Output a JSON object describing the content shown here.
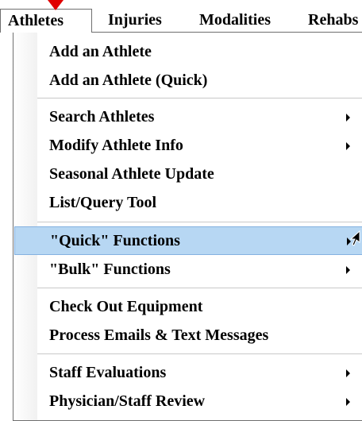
{
  "menubar": {
    "items": [
      {
        "label": "Athletes"
      },
      {
        "label": "Injuries"
      },
      {
        "label": "Modalities"
      },
      {
        "label": "Rehabs"
      }
    ]
  },
  "dropdown": {
    "items": [
      {
        "label": "Add an Athlete"
      },
      {
        "label": "Add an Athlete (Quick)"
      },
      {
        "label": "Search Athletes"
      },
      {
        "label": "Modify Athlete Info"
      },
      {
        "label": "Seasonal Athlete Update"
      },
      {
        "label": "List/Query Tool"
      },
      {
        "label": "\"Quick\" Functions"
      },
      {
        "label": "\"Bulk\" Functions"
      },
      {
        "label": "Check Out Equipment"
      },
      {
        "label": "Process Emails & Text Messages"
      },
      {
        "label": "Staff Evaluations"
      },
      {
        "label": "Physician/Staff Review"
      }
    ]
  },
  "colors": {
    "highlight": "#b7d7f3",
    "annotation_arrow": "#e00000"
  }
}
